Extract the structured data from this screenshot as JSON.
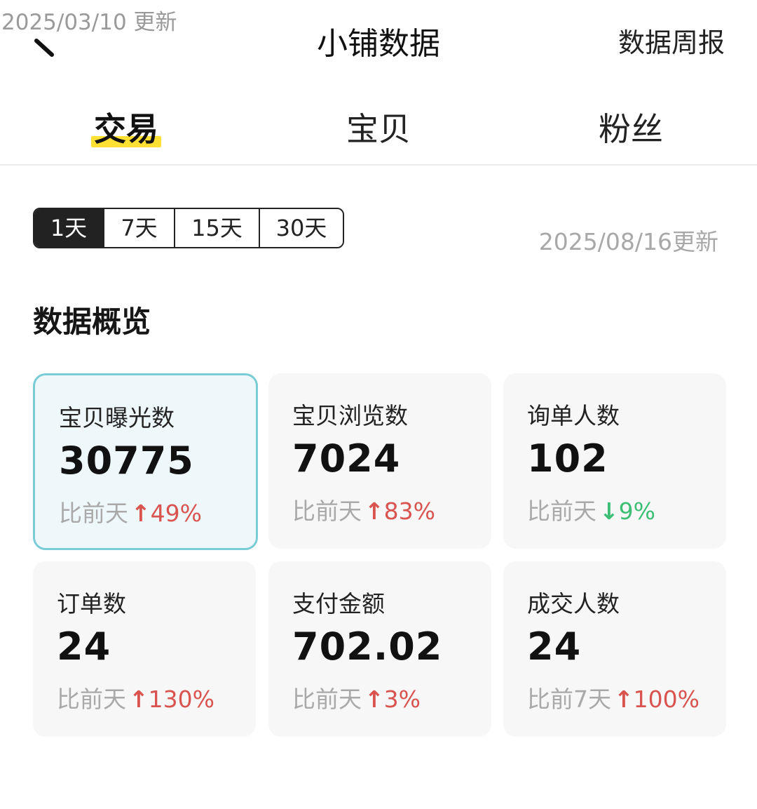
{
  "overlay": {
    "timestamp": "2025/03/10 更新"
  },
  "header": {
    "title": "小铺数据",
    "weekly_report": "数据周报"
  },
  "tabs": [
    {
      "label": "交易",
      "active": true
    },
    {
      "label": "宝贝",
      "active": false
    },
    {
      "label": "粉丝",
      "active": false
    }
  ],
  "periods": [
    {
      "label": "1天",
      "active": true
    },
    {
      "label": "7天",
      "active": false
    },
    {
      "label": "15天",
      "active": false
    },
    {
      "label": "30天",
      "active": false
    }
  ],
  "update_time": "2025/08/16更新",
  "section_title": "数据概览",
  "metrics": [
    {
      "label": "宝贝曝光数",
      "value": "30775",
      "compare_label": "比前天",
      "direction": "up",
      "change": "49%",
      "selected": true
    },
    {
      "label": "宝贝浏览数",
      "value": "7024",
      "compare_label": "比前天",
      "direction": "up",
      "change": "83%",
      "selected": false
    },
    {
      "label": "询单人数",
      "value": "102",
      "compare_label": "比前天",
      "direction": "down",
      "change": "9%",
      "selected": false
    },
    {
      "label": "订单数",
      "value": "24",
      "compare_label": "比前天",
      "direction": "up",
      "change": "130%",
      "selected": false
    },
    {
      "label": "支付金额",
      "value": "702.02",
      "compare_label": "比前天",
      "direction": "up",
      "change": "3%",
      "selected": false
    },
    {
      "label": "成交人数",
      "value": "24",
      "compare_label": "比前7天",
      "direction": "up",
      "change": "100%",
      "selected": false
    }
  ],
  "colors": {
    "accent_yellow": "#ffe033",
    "up": "#d9534f",
    "down": "#3cbf74",
    "selected_border": "#79cbd6",
    "selected_bg": "#eef8fb"
  }
}
